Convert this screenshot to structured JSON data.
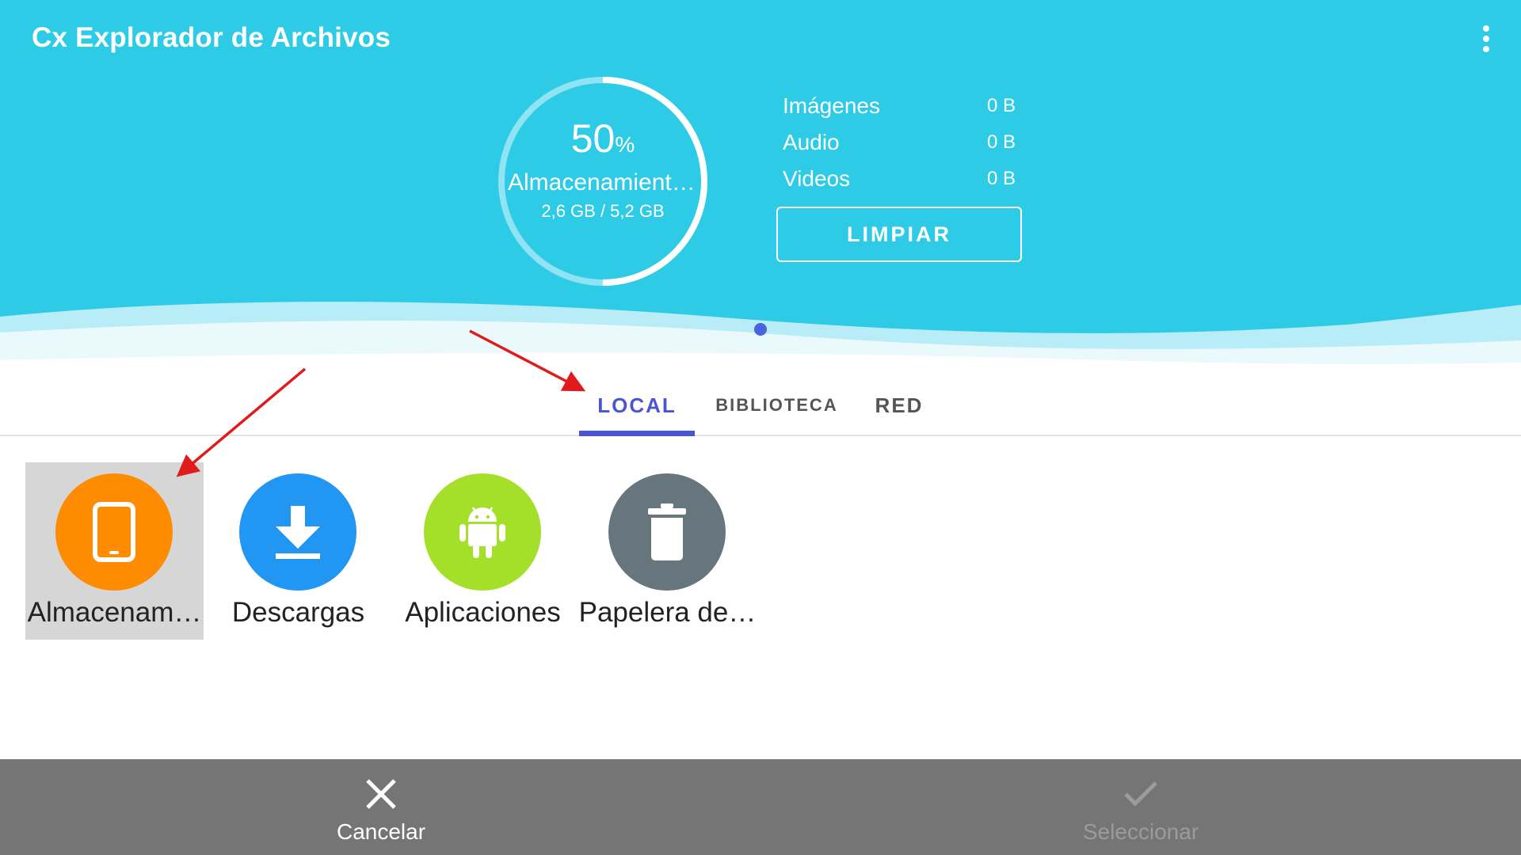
{
  "app": {
    "title": "Cx Explorador de Archivos"
  },
  "storage": {
    "percent": "50",
    "percent_unit": "%",
    "percent_value": 0.5,
    "name": "Almacenamiento interno",
    "usage": "2,6 GB / 5,2 GB"
  },
  "stats": [
    {
      "label": "Imágenes",
      "value": "0 B"
    },
    {
      "label": "Audio",
      "value": "0 B"
    },
    {
      "label": "Videos",
      "value": "0 B"
    }
  ],
  "clean_button": {
    "label": "LIMPIAR"
  },
  "tabs": [
    {
      "label": "LOCAL",
      "active": true
    },
    {
      "label": "BIBLIOTECA",
      "active": false
    },
    {
      "label": "RED",
      "active": false
    }
  ],
  "items": [
    {
      "label": "Almacenam…",
      "icon": "tablet-icon",
      "color": "#ff8c00",
      "selected": true
    },
    {
      "label": "Descargas",
      "icon": "download-icon",
      "color": "#2196f3",
      "selected": false
    },
    {
      "label": "Aplicaciones",
      "icon": "android-icon",
      "color": "#a4e02a",
      "selected": false
    },
    {
      "label": "Papelera de…",
      "icon": "trash-icon",
      "color": "#67767d",
      "selected": false
    }
  ],
  "bottom_bar": {
    "cancel_label": "Cancelar",
    "select_label": "Seleccionar"
  },
  "colors": {
    "header": "#2ecbe6",
    "accent": "#4a55d6",
    "bottom_bar": "#757575",
    "annotation_arrow": "#e01b1b"
  }
}
